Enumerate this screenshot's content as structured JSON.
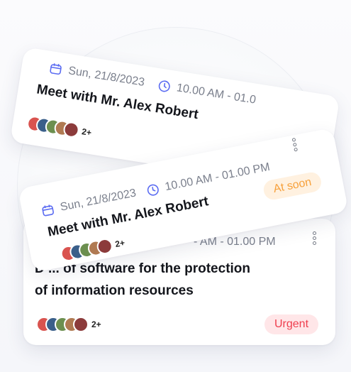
{
  "colors": {
    "accent": "#5b6cf2",
    "soon": "#f7a03a",
    "urgent": "#ef3d4d"
  },
  "cards": [
    {
      "date": "Sun, 21/8/2023",
      "time": "10.00 AM - 01.0",
      "title": "Meet with Mr. Alex Robert",
      "more": "2+"
    },
    {
      "time": "- AM - 01.00 PM",
      "desc_line1": "D          ...  of software for the protection",
      "desc_line2": "of information resources",
      "more": "2+",
      "badge": "Urgent"
    },
    {
      "date": "Sun, 21/8/2023",
      "time": "10.00 AM - 01.00 PM",
      "title": "Meet with Mr. Alex Robert",
      "more": "2+",
      "badge": "At soon"
    }
  ],
  "icons": [
    "calendar-icon",
    "clock-icon",
    "more-vertical-icon"
  ]
}
